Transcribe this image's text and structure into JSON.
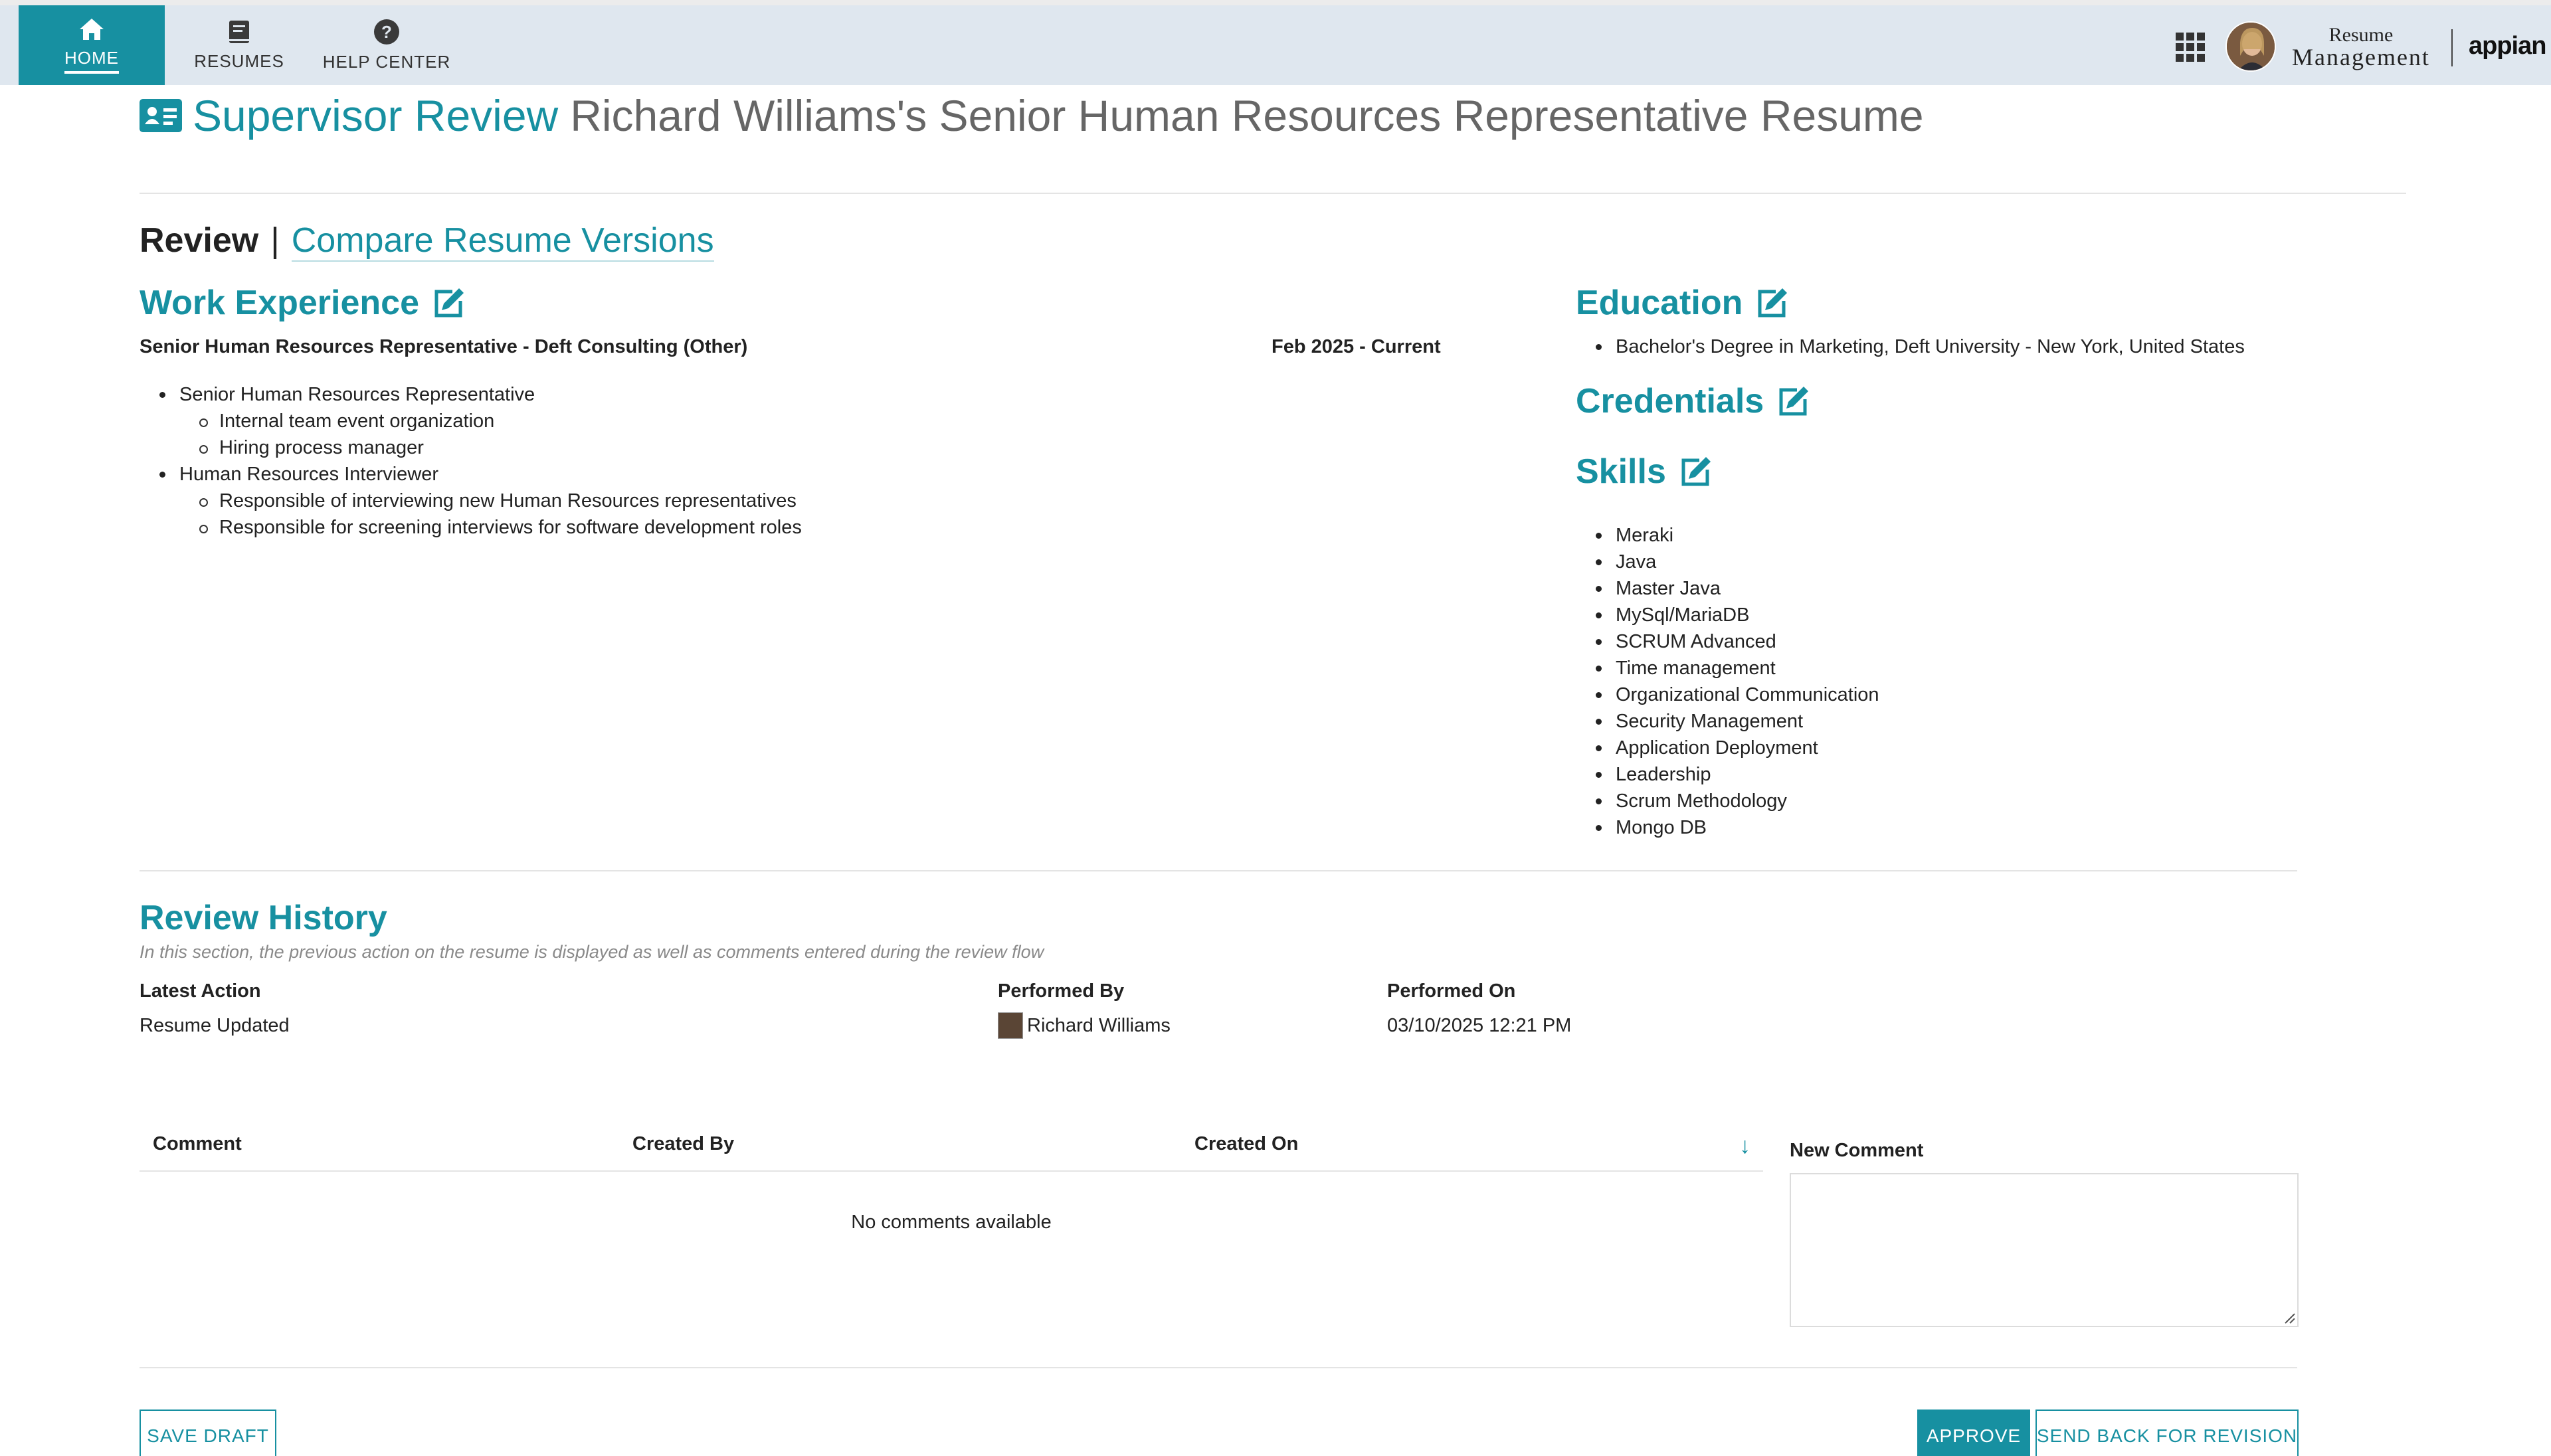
{
  "nav": {
    "tabs": [
      {
        "label": "HOME",
        "icon": "home-icon",
        "active": true
      },
      {
        "label": "RESUMES",
        "icon": "book-icon",
        "active": false
      },
      {
        "label": "HELP CENTER",
        "icon": "help-circle-icon",
        "active": false
      }
    ],
    "brand_line1": "Resume",
    "brand_line2": "Management",
    "vendor": "appian",
    "accent": "#1790a1"
  },
  "header": {
    "title": "Supervisor Review",
    "subtitle": "Richard Williams's Senior Human Resources Representative Resume"
  },
  "review_tabs": {
    "current": "Review",
    "separator": "|",
    "link": "Compare Resume Versions"
  },
  "work_experience": {
    "heading": "Work Experience",
    "job_title": "Senior Human Resources Representative - Deft Consulting (Other)",
    "dates": "Feb 2025 - Current",
    "items": [
      {
        "text": "Senior Human Resources Representative",
        "level": 1
      },
      {
        "text": "Internal team event organization",
        "level": 2
      },
      {
        "text": "Hiring process manager",
        "level": 2
      },
      {
        "text": "Human Resources Interviewer",
        "level": 1
      },
      {
        "text": "Responsible of interviewing new Human Resources representatives",
        "level": 2
      },
      {
        "text": "Responsible for screening interviews for software development roles",
        "level": 2
      }
    ]
  },
  "education": {
    "heading": "Education",
    "items": [
      "Bachelor's Degree in Marketing, Deft University - New York, United States"
    ]
  },
  "credentials": {
    "heading": "Credentials"
  },
  "skills": {
    "heading": "Skills",
    "items": [
      "Meraki",
      "Java",
      "Master Java",
      "MySql/MariaDB",
      "SCRUM Advanced",
      "Time management",
      "Organizational Communication",
      "Security Management",
      "Application Deployment",
      "Leadership",
      "Scrum Methodology",
      "Mongo DB"
    ]
  },
  "review_history": {
    "heading": "Review History",
    "description": "In this section, the previous action on the resume is displayed as well as comments entered during the review flow",
    "latest_action_label": "Latest Action",
    "latest_action_value": "Resume Updated",
    "performed_by_label": "Performed By",
    "performed_by_value": "Richard Williams",
    "performed_on_label": "Performed On",
    "performed_on_value": "03/10/2025 12:21 PM"
  },
  "comments": {
    "columns": [
      "Comment",
      "Created By",
      "Created On"
    ],
    "sort_icon": "arrow-down-icon",
    "empty_text": "No comments available",
    "new_comment_label": "New Comment",
    "new_comment_value": ""
  },
  "actions": {
    "save_draft": "SAVE DRAFT",
    "approve": "APPROVE",
    "send_back": "SEND BACK FOR REVISION"
  }
}
